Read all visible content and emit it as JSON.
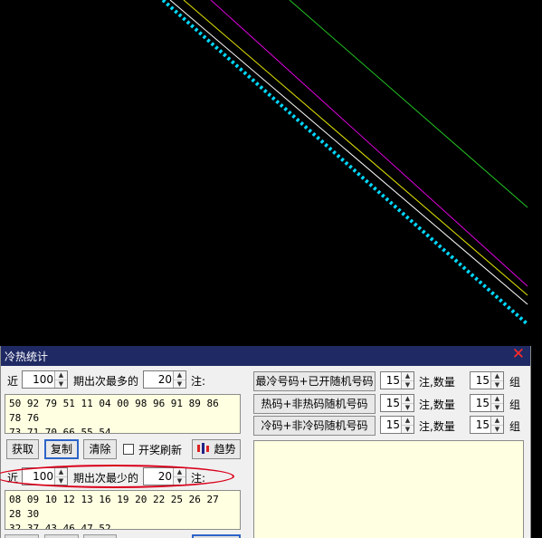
{
  "dialog": {
    "title": "冷热统计",
    "hot": {
      "prefix": "近",
      "periods": "100",
      "mid_label": "期出次最多的",
      "count": "20",
      "suffix": "注:",
      "numbers_line1": "50 92 79 51 11 04 00 98 96 91 89 86 78 76",
      "numbers_line2": "73 71 70 66 55 54"
    },
    "buttons": {
      "fetch": "获取",
      "copy": "复制",
      "clear": "清除",
      "draw_refresh": "开奖刷新",
      "trend": "趋势"
    },
    "draw_refresh_checked": false,
    "cold": {
      "prefix": "近",
      "periods": "100",
      "mid_label": "期出次最少的",
      "count": "20",
      "suffix": "注:",
      "numbers_line1": "08 09 10 12 13 16 19 20 22 25 26 27 28 30",
      "numbers_line2": "32 37 43 46 47 52"
    },
    "generators": [
      {
        "label": "最冷号码+已开随机号码",
        "notes": "15",
        "notes_unit": "注,数量",
        "qty": "15",
        "qty_unit": "组"
      },
      {
        "label": "热码+非热码随机号码",
        "notes": "15",
        "notes_unit": "注,数量",
        "qty": "15",
        "qty_unit": "组"
      },
      {
        "label": "冷码+非冷码随机号码",
        "notes": "15",
        "notes_unit": "注,数量",
        "qty": "15",
        "qty_unit": "组"
      }
    ]
  },
  "colors": {
    "titlebar": "#1f2a64",
    "close": "#ff2a2a",
    "highlight_ellipse": "#d9001b",
    "line_green": "#22c322",
    "line_magenta": "#e000e0",
    "line_yellow": "#e6e600",
    "line_white": "#ffffff",
    "line_cyan_dotted": "#00d8ff"
  },
  "icons": {
    "close": "close-icon",
    "trend": "trend-chart-icon",
    "spin": "spin-arrows-icon"
  }
}
